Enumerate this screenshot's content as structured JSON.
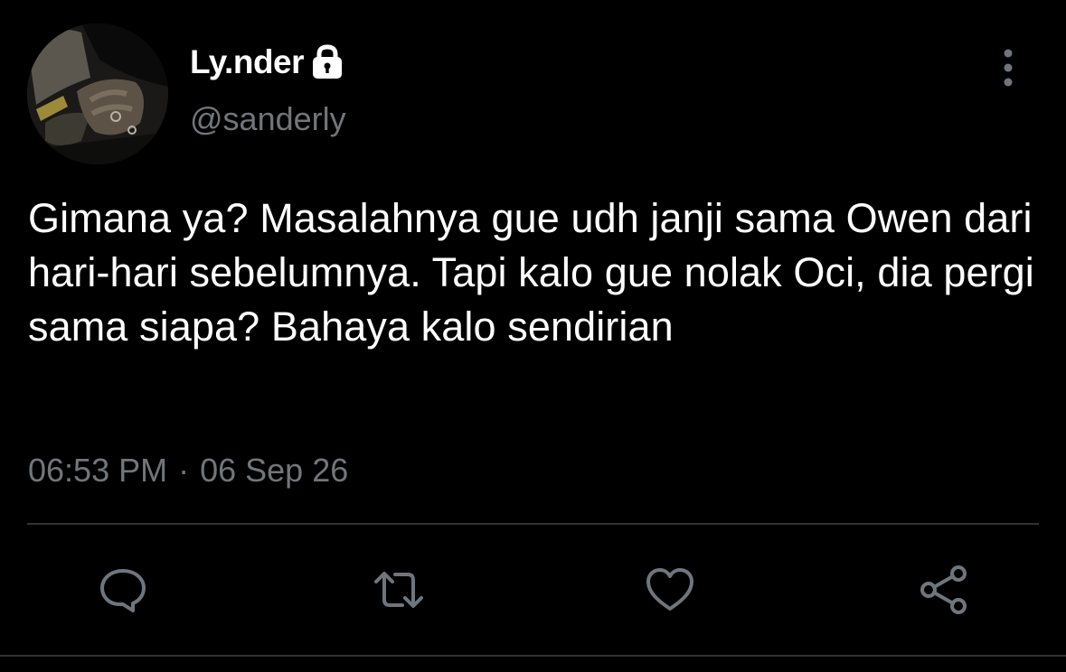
{
  "user": {
    "display_name": "Ly.nder",
    "handle": "@sanderly",
    "avatar_icon": "avatar-photo",
    "protected_icon": "lock-icon"
  },
  "tweet": {
    "text": "Gimana ya? Masalahnya gue udh janji sama Owen dari hari-hari sebelumnya. Tapi kalo gue nolak Oci, dia pergi sama siapa? Bahaya kalo sendirian",
    "time": "06:53 PM",
    "separator": "·",
    "date": "06 Sep 26"
  },
  "actions": [
    {
      "name": "reply",
      "icon": "reply-icon"
    },
    {
      "name": "retweet",
      "icon": "retweet-icon"
    },
    {
      "name": "like",
      "icon": "heart-icon"
    },
    {
      "name": "share",
      "icon": "share-icon"
    }
  ],
  "colors": {
    "background": "#000000",
    "primary_text": "#ffffff",
    "secondary_text": "#71767b",
    "icon": "#6e767d",
    "divider": "#2f3336"
  }
}
